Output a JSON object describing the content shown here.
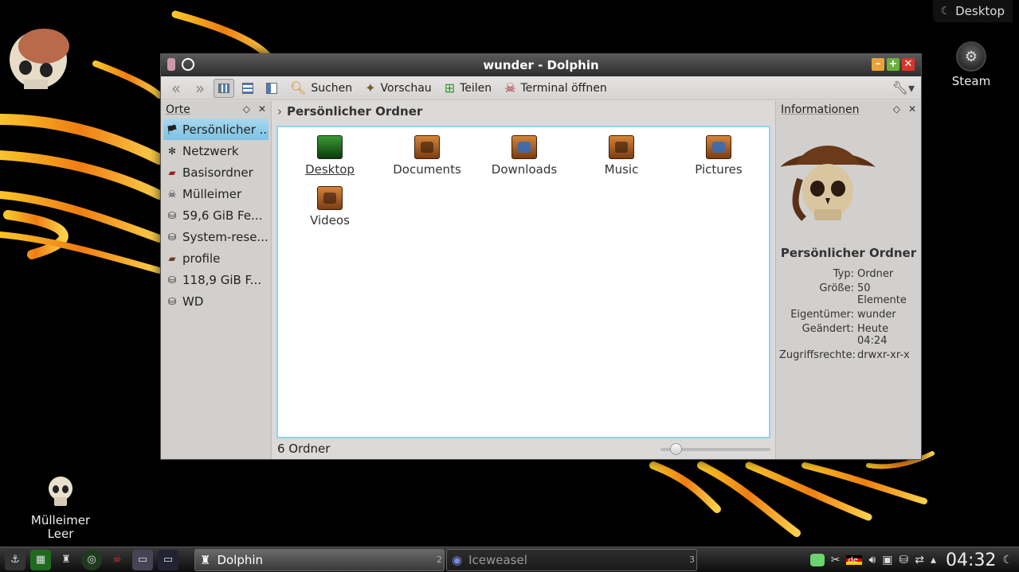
{
  "desktop": {
    "activity_label": "Desktop",
    "icons": [
      {
        "label": "Steam"
      },
      {
        "label": "Mülleimer\nLeer",
        "line1": "Mülleimer",
        "line2": "Leer"
      }
    ]
  },
  "window": {
    "title": "wunder - Dolphin",
    "toolbar": {
      "search_label": "Suchen",
      "preview_label": "Vorschau",
      "share_label": "Teilen",
      "terminal_label": "Terminal öffnen"
    },
    "places": {
      "title": "Orte",
      "items": [
        {
          "label": "Persönlicher ...",
          "icon": "home-icon"
        },
        {
          "label": "Netzwerk",
          "icon": "network-icon"
        },
        {
          "label": "Basisordner",
          "icon": "root-folder-icon"
        },
        {
          "label": "Mülleimer",
          "icon": "trash-icon"
        },
        {
          "label": "59,6 GiB Fe...",
          "icon": "drive-icon"
        },
        {
          "label": "System-rese...",
          "icon": "drive-icon"
        },
        {
          "label": "profile",
          "icon": "folder-icon"
        },
        {
          "label": "118,9 GiB F...",
          "icon": "drive-icon"
        },
        {
          "label": "WD",
          "icon": "drive-icon"
        }
      ]
    },
    "breadcrumb": "Persönlicher Ordner",
    "files": [
      {
        "label": "Desktop"
      },
      {
        "label": "Documents"
      },
      {
        "label": "Downloads"
      },
      {
        "label": "Music"
      },
      {
        "label": "Pictures"
      },
      {
        "label": "Videos"
      }
    ],
    "status": "6 Ordner",
    "zoom_level": 0.1,
    "info": {
      "title": "Informationen",
      "name": "Persönlicher Ordner",
      "fields": [
        {
          "key": "Typ:",
          "value": "Ordner"
        },
        {
          "key": "Größe:",
          "value": "50 Elemente"
        },
        {
          "key": "Eigentümer:",
          "value": "wunder"
        },
        {
          "key": "Geändert:",
          "value": "Heute 04:24"
        },
        {
          "key": "Zugriffsrechte:",
          "value": "drwxr-xr-x"
        }
      ]
    }
  },
  "taskbar": {
    "tasks": [
      {
        "label": "Dolphin",
        "count": "2"
      },
      {
        "label": "Iceweasel",
        "count": "3"
      }
    ],
    "keyboard_layout": "de",
    "clock": "04:32"
  },
  "colors": {
    "selection": "#7cc2e5",
    "view_border": "#8ed3f0",
    "close_button": "#d9342b",
    "max_button": "#6cb03c",
    "min_button": "#e9a23b"
  }
}
